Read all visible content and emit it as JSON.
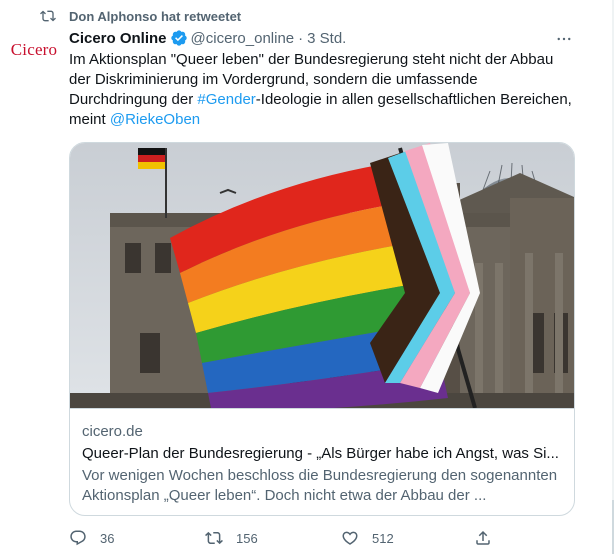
{
  "retweet": {
    "label": "Don Alphonso hat retweetet"
  },
  "author": {
    "avatar_text": "Cicero",
    "name": "Cicero Online",
    "handle": "@cicero_online",
    "separator": "·",
    "time": "3 Std."
  },
  "tweet": {
    "line1": "Im Aktionsplan \"Queer leben\" der Bundesregierung steht nicht der Abbau",
    "line2": "der Diskriminierung im Vordergrund, sondern die umfassende",
    "line3_pre": "Durchdringung der ",
    "hashtag": "#Gender",
    "line3_post": "-Ideologie in allen gesellschaftlichen Bereichen,",
    "line4_pre": "meint ",
    "mention": "@RiekeOben"
  },
  "card": {
    "image_icon": "photo-reichstag-pride-flag",
    "domain": "cicero.de",
    "title": "Queer-Plan der Bundesregierung - „Als Bürger habe ich Angst, was Si...",
    "description_line1": "Vor wenigen Wochen beschloss die Bundesregierung den sogenannten",
    "description_line2": "Aktionsplan „Queer leben“. Doch nicht etwa der Abbau der ..."
  },
  "actions": {
    "reply_count": "36",
    "retweet_count": "156",
    "like_count": "512"
  },
  "colors": {
    "accent": "#1d9bf0",
    "muted_text": "#536471",
    "brand_red": "#c8102e"
  }
}
